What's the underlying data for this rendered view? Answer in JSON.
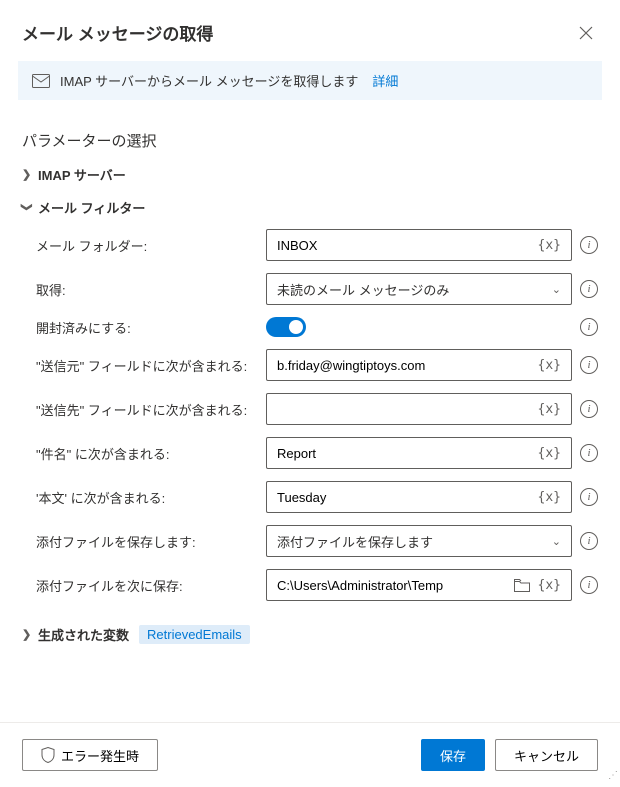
{
  "header": {
    "title": "メール メッセージの取得"
  },
  "info": {
    "text": "IMAP サーバーからメール メッセージを取得します",
    "details_label": "詳細"
  },
  "section_title": "パラメーターの選択",
  "groups": {
    "imap_server": {
      "label": "IMAP サーバー"
    },
    "mail_filter": {
      "label": "メール フィルター"
    },
    "generated_vars": {
      "label": "生成された変数",
      "var_name": "RetrievedEmails"
    }
  },
  "fields": {
    "folder": {
      "label": "メール フォルダー:",
      "value": "INBOX"
    },
    "retrieve": {
      "label": "取得:",
      "value": "未読のメール メッセージのみ"
    },
    "mark_read": {
      "label": "開封済みにする:"
    },
    "from": {
      "label": "\"送信元\" フィールドに次が含まれる:",
      "value": "b.friday@wingtiptoys.com"
    },
    "to": {
      "label": "\"送信先\" フィールドに次が含まれる:",
      "value": ""
    },
    "subject": {
      "label": "\"件名\" に次が含まれる:",
      "value": "Report"
    },
    "body": {
      "label": "'本文' に次が含まれる:",
      "value": "Tuesday"
    },
    "save_attach": {
      "label": "添付ファイルを保存します:",
      "value": "添付ファイルを保存します"
    },
    "save_to": {
      "label": "添付ファイルを次に保存:",
      "value": "C:\\Users\\Administrator\\Temp"
    }
  },
  "footer": {
    "on_error": "エラー発生時",
    "save": "保存",
    "cancel": "キャンセル"
  },
  "glyphs": {
    "var": "{x}"
  }
}
